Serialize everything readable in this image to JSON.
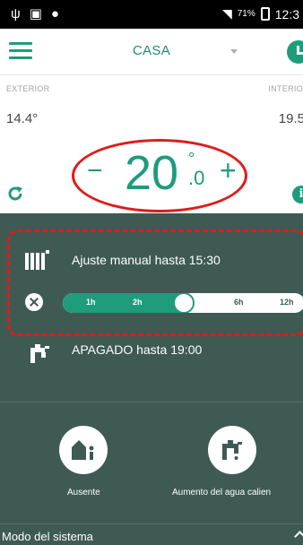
{
  "status_bar": {
    "battery_text": "71%",
    "time": "12:3"
  },
  "header": {
    "title": "CASA"
  },
  "temps": {
    "exterior_label": "EXTERIOR",
    "exterior_value": "14.4°",
    "interior_label": "INTERIO",
    "interior_value": "19.5"
  },
  "setpoint": {
    "minus": "−",
    "integer": "20",
    "degree": "°",
    "decimal": ".0",
    "plus": "+"
  },
  "manual": {
    "text": "Ajuste manual hasta 15:30"
  },
  "slider": {
    "ticks": [
      "1h",
      "2h",
      "6h",
      "12h"
    ],
    "position_fraction": 0.5
  },
  "dhw": {
    "text": "APAGADO hasta 19:00"
  },
  "actions": {
    "away_label": "Ausente",
    "boost_label": "Aumento del agua calien"
  },
  "footer": {
    "system_mode_label": "Modo del sistema"
  },
  "colors": {
    "accent": "#1e9c7c",
    "panel": "#3e5a53",
    "annotation": "#e01b1b"
  }
}
